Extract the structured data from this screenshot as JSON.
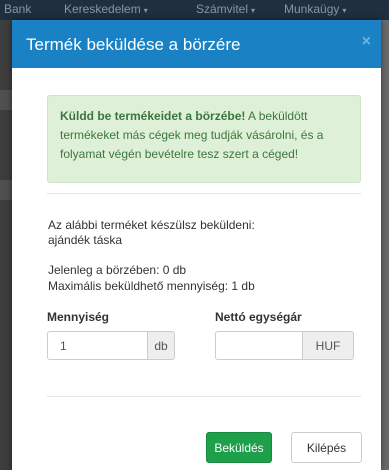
{
  "navbar": {
    "items": [
      "Bank",
      "Kereskedelem",
      "Számvitel",
      "Munkaügy"
    ],
    "caret": "▾"
  },
  "modal": {
    "title": "Termék beküldése a börzére",
    "close_icon": "×",
    "alert": {
      "bold": "Küldd be termékeidet a börzébe!",
      "text": " A beküldött termékeket más cégek meg tudják vásárolni, és a folyamat végén bevételre tesz szert a céged!"
    },
    "info": {
      "product_line": "Az alábbi terméket készülsz beküldeni: ajándék táska",
      "current_line": "Jelenleg a börzében: 0 db",
      "max_line": "Maximális beküldhető mennyiség: 1 db"
    },
    "form": {
      "quantity_label": "Mennyiség",
      "quantity_value": "1",
      "quantity_unit": "db",
      "price_label": "Nettó egységár",
      "price_value": "",
      "price_unit": "HUF"
    },
    "buttons": {
      "submit": "Beküldés",
      "cancel": "Kilépés"
    }
  },
  "colors": {
    "header": "#1a82c4",
    "primary_button": "#1e9f4a",
    "alert_bg": "#dff0d8",
    "alert_text": "#3c763d"
  }
}
